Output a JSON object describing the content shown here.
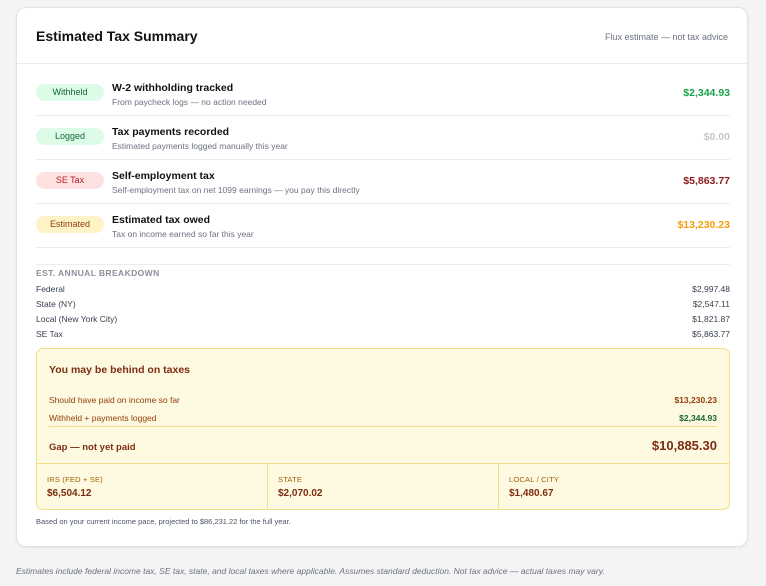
{
  "header": {
    "title": "Estimated Tax Summary",
    "note": "Flux estimate — not tax advice"
  },
  "rows": [
    {
      "pill": "Withheld",
      "title": "W-2 withholding tracked",
      "subtitle": "From paycheck logs — no action needed",
      "amount": "$2,344.93",
      "pill_bg": "#dcfce7",
      "pill_color": "#166534",
      "amount_color": "#16a34a"
    },
    {
      "pill": "Logged",
      "title": "Tax payments recorded",
      "subtitle": "Estimated payments logged manually this year",
      "amount": "$0.00",
      "pill_bg": "#dcfce7",
      "pill_color": "#166534",
      "amount_color": "#c4c7cc"
    },
    {
      "pill": "SE Tax",
      "title": "Self-employment tax",
      "subtitle": "Self-employment tax on net 1099 earnings — you pay this directly",
      "amount": "$5,863.77",
      "pill_bg": "#fee2e2",
      "pill_color": "#b91c1c",
      "amount_color": "#8b1a1a"
    },
    {
      "pill": "Estimated",
      "title": "Estimated tax owed",
      "subtitle": "Tax on income earned so far this year",
      "amount": "$13,230.23",
      "pill_bg": "#fef3c7",
      "pill_color": "#92400e",
      "amount_color": "#f59e0b"
    }
  ],
  "breakdown": {
    "heading": "EST. ANNUAL BREAKDOWN",
    "items": [
      {
        "label": "Federal",
        "amount": "$2,997.48"
      },
      {
        "label": "State (NY)",
        "amount": "$2,547.11"
      },
      {
        "label": "Local (New York City)",
        "amount": "$1,821.87"
      },
      {
        "label": "SE Tax",
        "amount": "$5,863.77"
      }
    ]
  },
  "warning": {
    "title": "You may be behind on taxes",
    "should_label": "Should have paid on income so far",
    "should_amount": "$13,230.23",
    "withheld_label": "Withheld + payments logged",
    "withheld_amount": "$2,344.93",
    "withheld_color": "#166534",
    "gap_label": "Gap — not yet paid",
    "gap_amount": "$10,885.30",
    "jurisdictions": [
      {
        "label": "IRS (FED + SE)",
        "amount": "$6,504.12"
      },
      {
        "label": "STATE",
        "amount": "$2,070.02"
      },
      {
        "label": "LOCAL / CITY",
        "amount": "$1,480.67"
      }
    ]
  },
  "pace_note": "Based on your current income pace, projected to $86,231.22 for the full year.",
  "footer": "Estimates include federal income tax, SE tax, state, and local taxes where applicable. Assumes standard deduction. Not tax advice — actual taxes may vary."
}
